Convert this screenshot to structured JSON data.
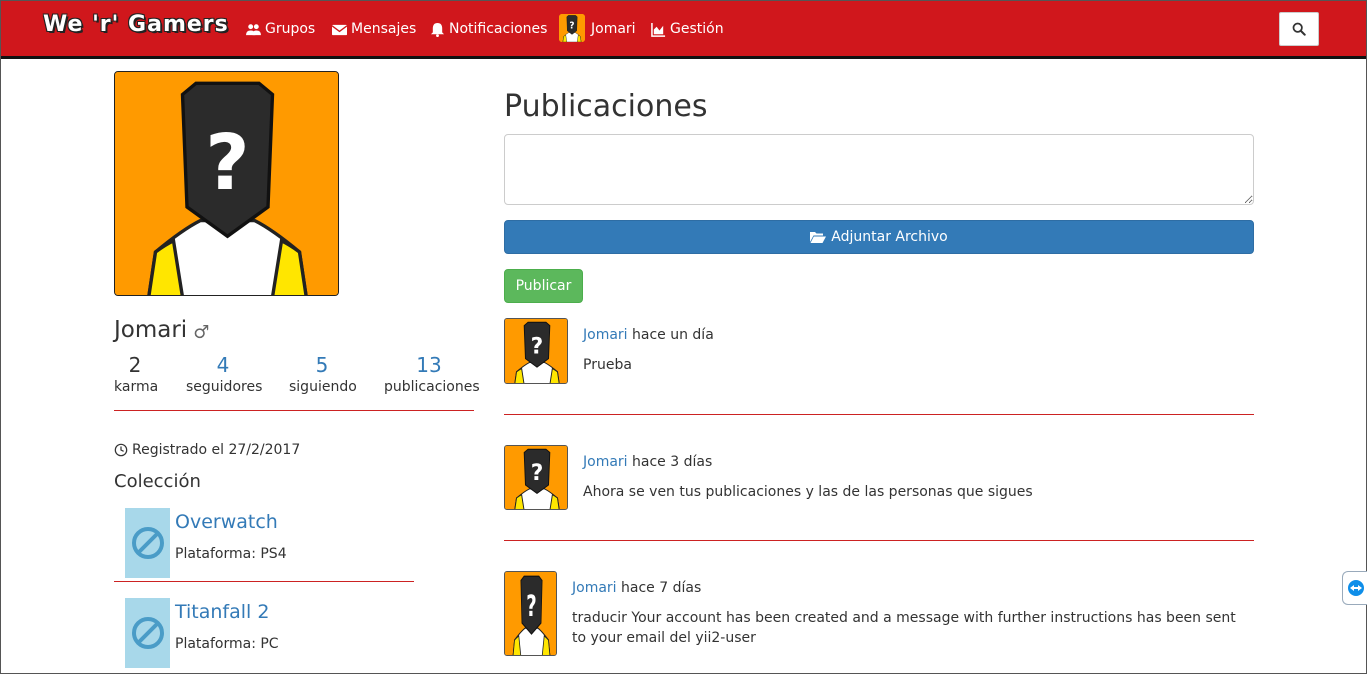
{
  "navbar": {
    "brand": "We 'r' Gamers",
    "items": [
      {
        "label": "Grupos",
        "icon": "users-icon"
      },
      {
        "label": "Mensajes",
        "icon": "envelope-icon"
      },
      {
        "label": "Notificaciones",
        "icon": "bell-icon"
      },
      {
        "label": "Jomari",
        "icon": "avatar"
      },
      {
        "label": "Gestión",
        "icon": "area-chart-icon"
      }
    ],
    "search_icon": "search-icon"
  },
  "profile": {
    "name": "Jomari",
    "gender_symbol": "♂",
    "stats": [
      {
        "value": "2",
        "label": "karma"
      },
      {
        "value": "4",
        "label": "seguidores"
      },
      {
        "value": "5",
        "label": "siguiendo"
      },
      {
        "value": "13",
        "label": "publicaciones"
      }
    ],
    "registered": "Registrado el 27/2/2017",
    "collection_title": "Colección",
    "games": [
      {
        "title": "Overwatch",
        "platform": "Plataforma: PS4"
      },
      {
        "title": "Titanfall 2",
        "platform": "Plataforma: PC"
      }
    ]
  },
  "feed": {
    "title": "Publicaciones",
    "input_placeholder": "",
    "attach_label": "Adjuntar Archivo",
    "publish_label": "Publicar",
    "posts": [
      {
        "author": "Jomari",
        "time": "hace un día",
        "text": "Prueba"
      },
      {
        "author": "Jomari",
        "time": "hace 3 días",
        "text": "Ahora se ven tus publicaciones y las de las personas que sigues"
      },
      {
        "author": "Jomari",
        "time": "hace 7 días",
        "text": "traducir Your account has been created and a message with further instructions has been sent to your email del yii2-user"
      }
    ]
  },
  "colors": {
    "navbar": "#d0171c",
    "link": "#337ab7",
    "primary_button": "#337ab7",
    "success_button": "#5cb85c",
    "separator": "#cc2222",
    "avatar_bg": "#ff9a00"
  }
}
